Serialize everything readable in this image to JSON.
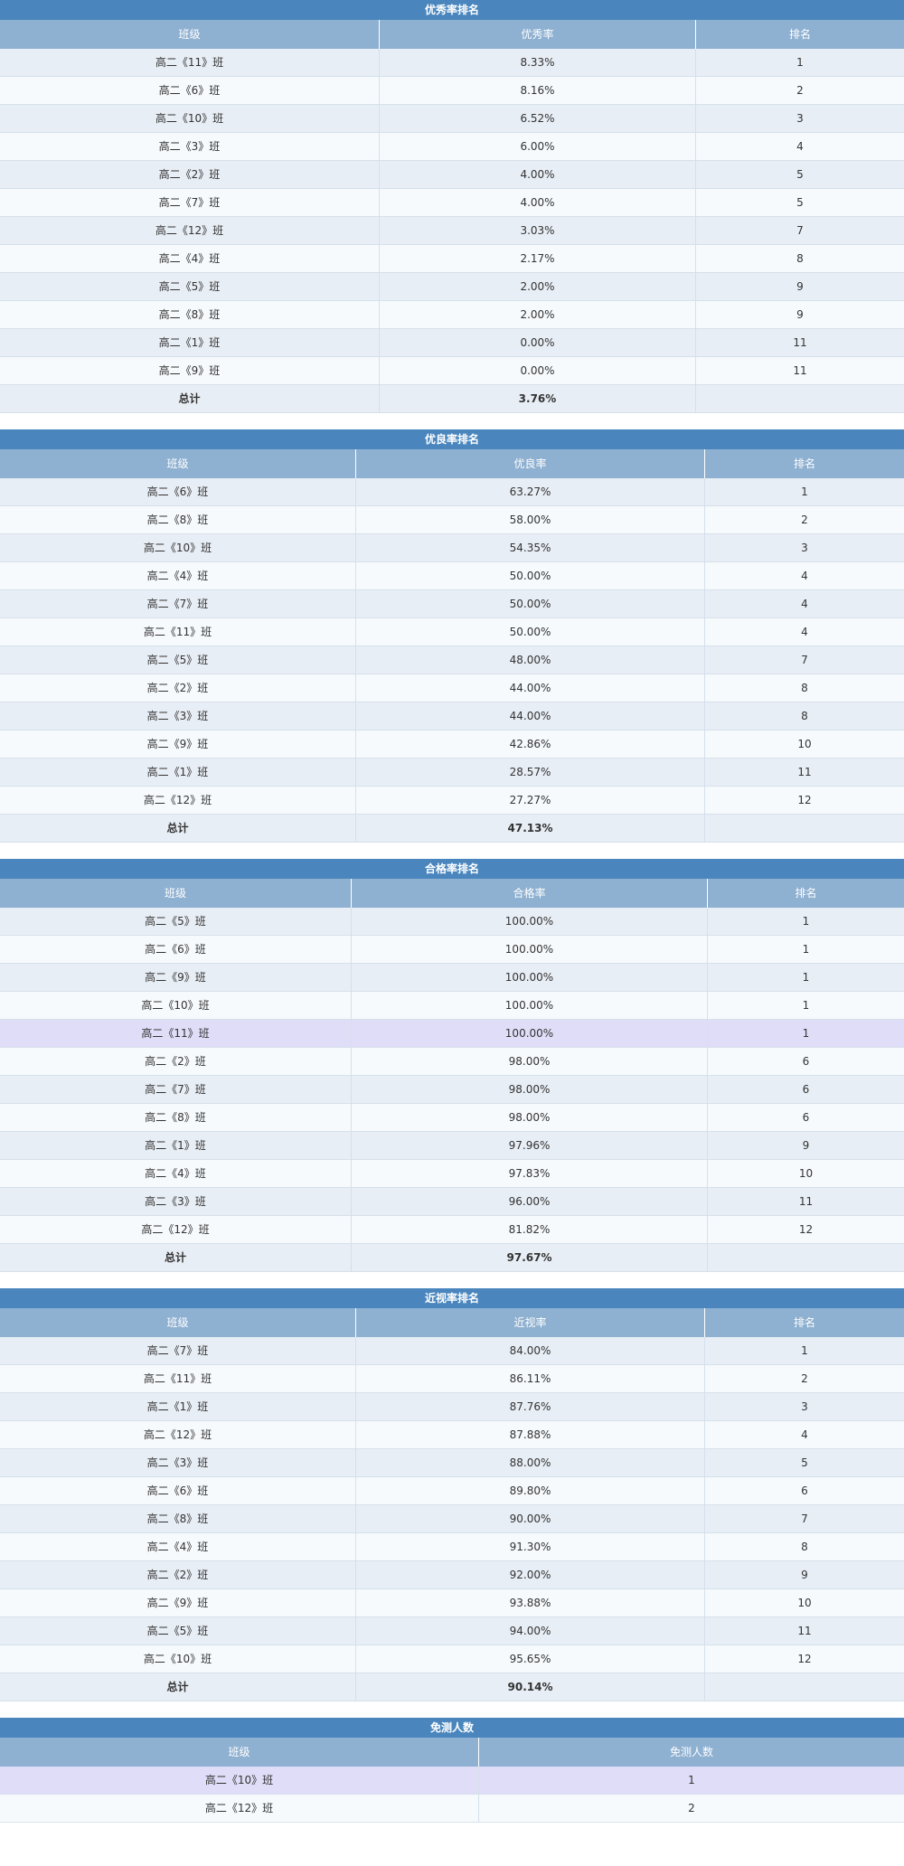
{
  "tables": [
    {
      "title": "优秀率排名",
      "headers": [
        "班级",
        "优秀率",
        "排名"
      ],
      "rows": [
        [
          "高二《11》班",
          "8.33%",
          "1"
        ],
        [
          "高二《6》班",
          "8.16%",
          "2"
        ],
        [
          "高二《10》班",
          "6.52%",
          "3"
        ],
        [
          "高二《3》班",
          "6.00%",
          "4"
        ],
        [
          "高二《2》班",
          "4.00%",
          "5"
        ],
        [
          "高二《7》班",
          "4.00%",
          "5"
        ],
        [
          "高二《12》班",
          "3.03%",
          "7"
        ],
        [
          "高二《4》班",
          "2.17%",
          "8"
        ],
        [
          "高二《5》班",
          "2.00%",
          "9"
        ],
        [
          "高二《8》班",
          "2.00%",
          "9"
        ],
        [
          "高二《1》班",
          "0.00%",
          "11"
        ],
        [
          "高二《9》班",
          "0.00%",
          "11"
        ]
      ],
      "total": [
        "总计",
        "3.76%",
        ""
      ]
    },
    {
      "title": "优良率排名",
      "headers": [
        "班级",
        "优良率",
        "排名"
      ],
      "rows": [
        [
          "高二《6》班",
          "63.27%",
          "1"
        ],
        [
          "高二《8》班",
          "58.00%",
          "2"
        ],
        [
          "高二《10》班",
          "54.35%",
          "3"
        ],
        [
          "高二《4》班",
          "50.00%",
          "4"
        ],
        [
          "高二《7》班",
          "50.00%",
          "4"
        ],
        [
          "高二《11》班",
          "50.00%",
          "4"
        ],
        [
          "高二《5》班",
          "48.00%",
          "7"
        ],
        [
          "高二《2》班",
          "44.00%",
          "8"
        ],
        [
          "高二《3》班",
          "44.00%",
          "8"
        ],
        [
          "高二《9》班",
          "42.86%",
          "10"
        ],
        [
          "高二《1》班",
          "28.57%",
          "11"
        ],
        [
          "高二《12》班",
          "27.27%",
          "12"
        ]
      ],
      "total": [
        "总计",
        "47.13%",
        ""
      ]
    },
    {
      "title": "合格率排名",
      "headers": [
        "班级",
        "合格率",
        "排名"
      ],
      "rows": [
        [
          "高二《5》班",
          "100.00%",
          "1"
        ],
        [
          "高二《6》班",
          "100.00%",
          "1"
        ],
        [
          "高二《9》班",
          "100.00%",
          "1"
        ],
        [
          "高二《10》班",
          "100.00%",
          "1"
        ],
        [
          "高二《11》班",
          "100.00%",
          "1"
        ],
        [
          "高二《2》班",
          "98.00%",
          "6"
        ],
        [
          "高二《7》班",
          "98.00%",
          "6"
        ],
        [
          "高二《8》班",
          "98.00%",
          "6"
        ],
        [
          "高二《1》班",
          "97.96%",
          "9"
        ],
        [
          "高二《4》班",
          "97.83%",
          "10"
        ],
        [
          "高二《3》班",
          "96.00%",
          "11"
        ],
        [
          "高二《12》班",
          "81.82%",
          "12"
        ]
      ],
      "total": [
        "总计",
        "97.67%",
        ""
      ]
    },
    {
      "title": "近视率排名",
      "headers": [
        "班级",
        "近视率",
        "排名"
      ],
      "rows": [
        [
          "高二《7》班",
          "84.00%",
          "1"
        ],
        [
          "高二《11》班",
          "86.11%",
          "2"
        ],
        [
          "高二《1》班",
          "87.76%",
          "3"
        ],
        [
          "高二《12》班",
          "87.88%",
          "4"
        ],
        [
          "高二《3》班",
          "88.00%",
          "5"
        ],
        [
          "高二《6》班",
          "89.80%",
          "6"
        ],
        [
          "高二《8》班",
          "90.00%",
          "7"
        ],
        [
          "高二《4》班",
          "91.30%",
          "8"
        ],
        [
          "高二《2》班",
          "92.00%",
          "9"
        ],
        [
          "高二《9》班",
          "93.88%",
          "10"
        ],
        [
          "高二《5》班",
          "94.00%",
          "11"
        ],
        [
          "高二《10》班",
          "95.65%",
          "12"
        ]
      ],
      "total": [
        "总计",
        "90.14%",
        ""
      ]
    },
    {
      "title": "免测人数",
      "headers": [
        "班级",
        "免测人数"
      ],
      "rows": [
        [
          "高二《10》班",
          "1"
        ],
        [
          "高二《12》班",
          "2"
        ]
      ],
      "total": null
    }
  ],
  "colors": {
    "title_bar": "#4a86bd",
    "header": "#8eb0d1",
    "row_odd": "#e8eef5",
    "row_even": "#f7fafd",
    "row_highlight": "#e0ddf8"
  }
}
